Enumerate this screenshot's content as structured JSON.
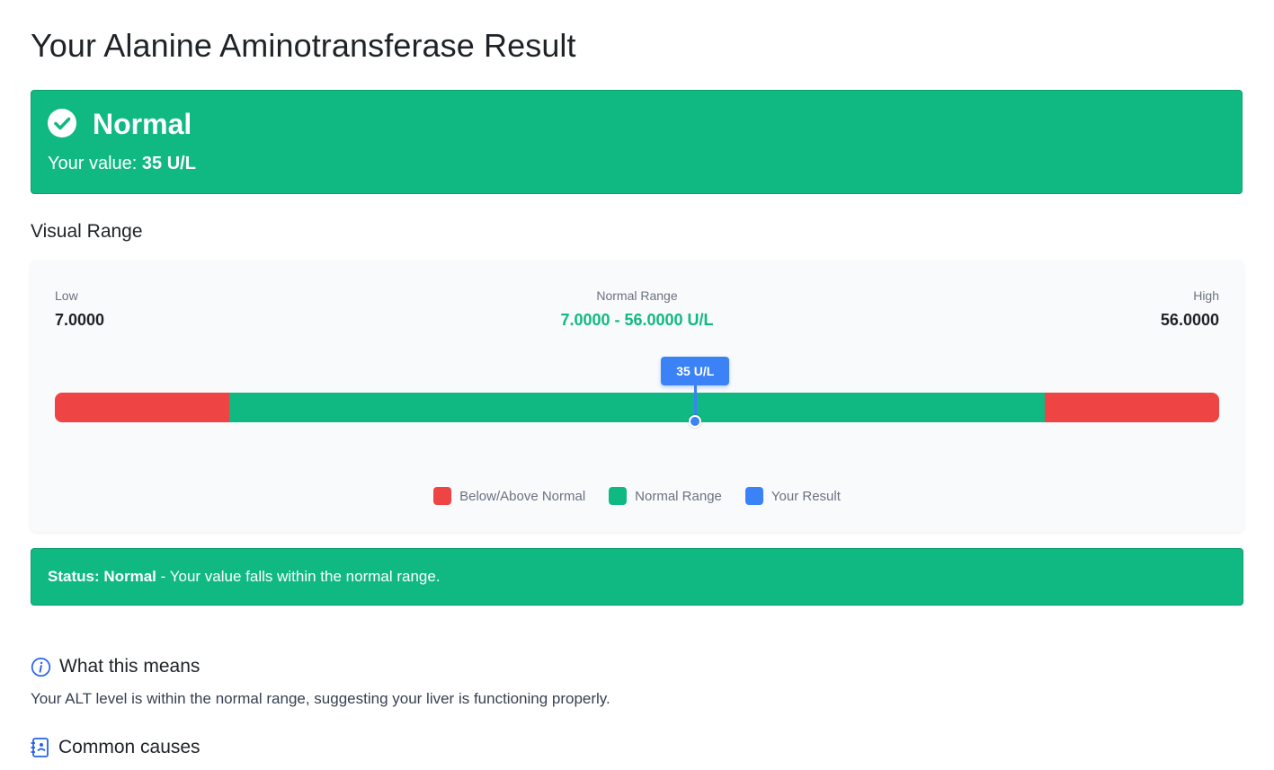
{
  "page": {
    "title": "Your Alanine Aminotransferase Result"
  },
  "result": {
    "status": "Normal",
    "value_prefix": "Your value:",
    "value": "35 U/L"
  },
  "visual_range": {
    "title": "Visual Range",
    "low_caption": "Low",
    "low_value": "7.0000",
    "normal_caption": "Normal Range",
    "normal_value": "7.0000 - 56.0000 U/L",
    "high_caption": "High",
    "high_value": "56.0000",
    "marker_label": "35 U/L",
    "marker_value": 35,
    "range_min": 7,
    "range_max": 56,
    "legend": [
      {
        "label": "Below/Above Normal",
        "color": "#ef4444"
      },
      {
        "label": "Normal Range",
        "color": "#10b981"
      },
      {
        "label": "Your Result",
        "color": "#3b82f6"
      }
    ]
  },
  "status_bar": {
    "label": "Status: Normal",
    "message": " - Your value falls within the normal range."
  },
  "what_this_means": {
    "title": "What this means",
    "text": "Your ALT level is within the normal range, suggesting your liver is functioning properly."
  },
  "common_causes": {
    "title": "Common causes"
  },
  "colors": {
    "normal": "#10b981",
    "abnormal": "#ef4444",
    "result": "#3b82f6"
  },
  "icons": {
    "status": "check-circle-icon",
    "info": "info-circle-icon",
    "list": "clipboard-list-icon"
  }
}
